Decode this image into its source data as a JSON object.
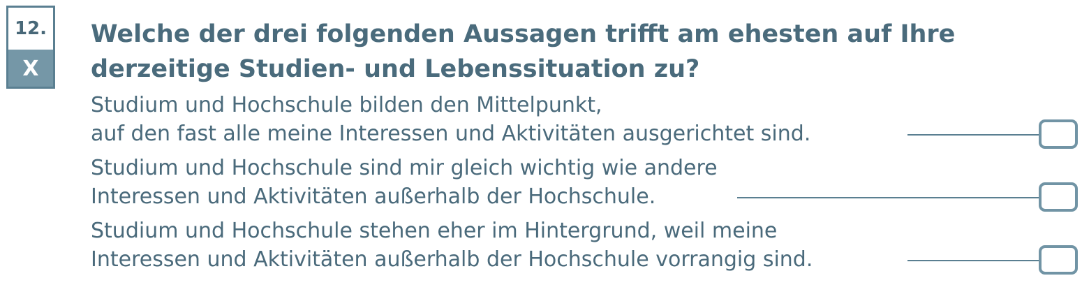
{
  "question": {
    "number": "12.",
    "marker": "X",
    "title_line1": "Welche der drei folgenden Aussagen trifft am ehesten auf Ihre",
    "title_line2": "derzeitige Studien- und Lebenssituation zu?"
  },
  "options": [
    {
      "line1": "Studium und Hochschule bilden den Mittelpunkt,",
      "line2": "auf den fast alle meine Interessen und Aktivitäten ausgerichtet sind."
    },
    {
      "line1": "Studium und Hochschule sind mir gleich wichtig wie andere",
      "line2": "Interessen und Aktivitäten außerhalb der Hochschule."
    },
    {
      "line1": "Studium und Hochschule stehen eher im Hintergrund, weil meine",
      "line2": "Interessen und Aktivitäten außerhalb der Hochschule vorrangig sind."
    }
  ],
  "colors": {
    "text": "#4a6a7b",
    "badge_fill": "#7597a7",
    "checkbox_border": "#7194a5"
  }
}
